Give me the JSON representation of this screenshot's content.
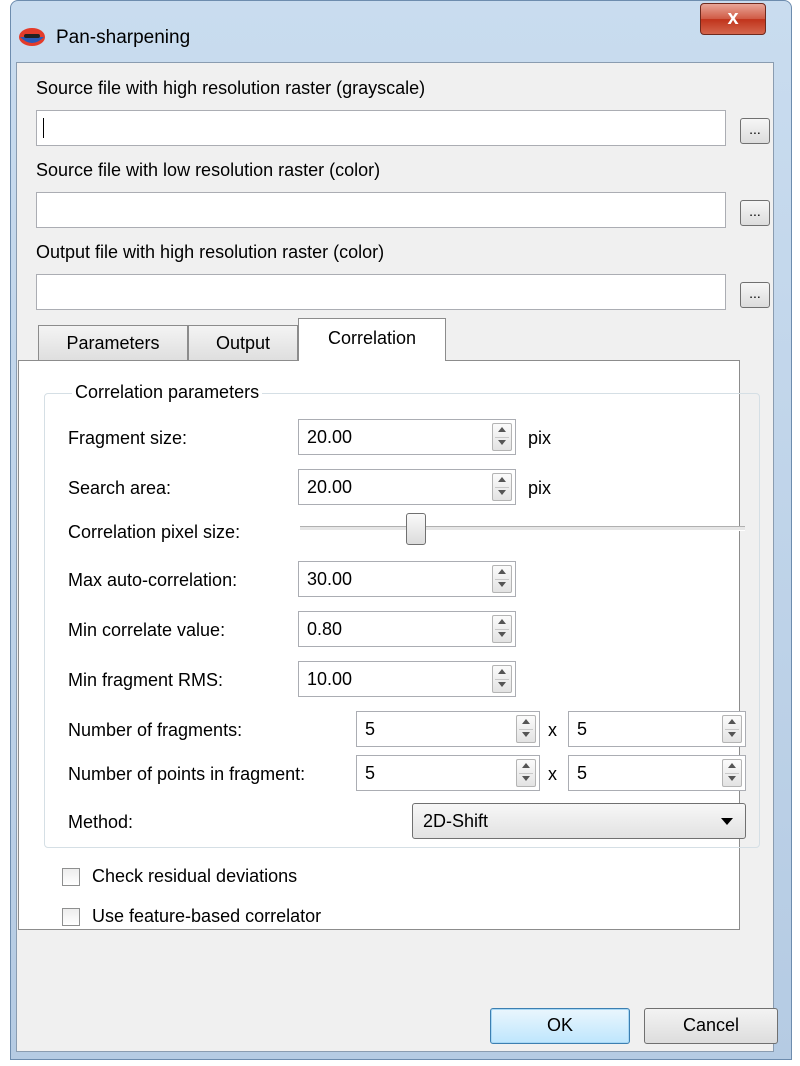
{
  "window": {
    "title": "Pan-sharpening",
    "close_label": "x"
  },
  "files": {
    "high_res_label": "Source file with high resolution raster (grayscale)",
    "high_res_value": "",
    "low_res_label": "Source file with low resolution raster (color)",
    "low_res_value": "",
    "output_label": "Output file with high resolution raster (color)",
    "output_value": "",
    "browse_label": "..."
  },
  "tabs": [
    {
      "label": "Parameters",
      "active": false
    },
    {
      "label": "Output",
      "active": false
    },
    {
      "label": "Correlation",
      "active": true
    }
  ],
  "correlation": {
    "group_title": "Correlation parameters",
    "fragment_size": {
      "label": "Fragment size:",
      "value": "20.00",
      "unit": "pix"
    },
    "search_area": {
      "label": "Search area:",
      "value": "20.00",
      "unit": "pix"
    },
    "pixel_size": {
      "label": "Correlation pixel size:",
      "slider_fraction": 0.26
    },
    "max_auto": {
      "label": "Max auto-correlation:",
      "value": "30.00"
    },
    "min_correlate": {
      "label": "Min correlate value:",
      "value": "0.80"
    },
    "min_rms": {
      "label": "Min fragment RMS:",
      "value": "10.00"
    },
    "num_fragments": {
      "label": "Number of fragments:",
      "x_value": "5",
      "y_value": "5",
      "sep": "x"
    },
    "num_points": {
      "label": "Number of points in fragment:",
      "x_value": "5",
      "y_value": "5",
      "sep": "x"
    },
    "method": {
      "label": "Method:",
      "value": "2D-Shift"
    }
  },
  "checks": {
    "residual": {
      "label": "Check residual deviations",
      "checked": false
    },
    "feature": {
      "label": "Use feature-based correlator",
      "checked": false
    }
  },
  "buttons": {
    "ok": "OK",
    "cancel": "Cancel"
  },
  "colors": {
    "titlebar": "#c9dcef",
    "close_button": "#c0331b",
    "default_button": "#bee6fd"
  }
}
